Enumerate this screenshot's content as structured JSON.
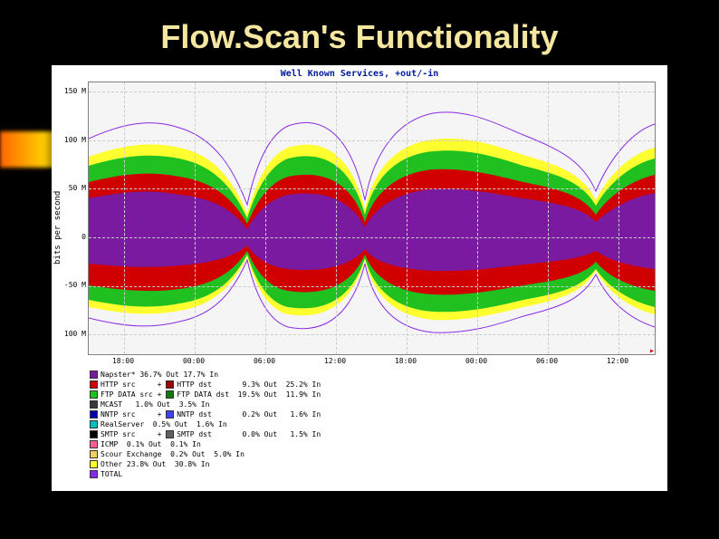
{
  "slide": {
    "title": "Flow.Scan's Functionality"
  },
  "chart_data": {
    "type": "area",
    "title": "Well Known Services, +out/-in",
    "ylabel": "bits per second",
    "xlabel": "",
    "ylim": [
      -120,
      160
    ],
    "y_unit": "M",
    "y_ticks": [
      "150 M",
      "100 M",
      "50 M",
      "0",
      "-50 M",
      "100 M"
    ],
    "x_ticks": [
      "18:00",
      "00:00",
      "06:00",
      "12:00",
      "18:00",
      "00:00",
      "06:00",
      "12:00"
    ],
    "series": [
      {
        "name": "Napster*",
        "color": "#7a1aa0",
        "out_pct": 36.7,
        "in_pct": 17.7
      },
      {
        "name": "HTTP src",
        "color": "#d00000",
        "pair": "HTTP dst",
        "pair_color": "#a00000",
        "out_pct": 9.3,
        "in_pct": 25.2
      },
      {
        "name": "FTP DATA src",
        "color": "#20c020",
        "pair": "FTP DATA dst",
        "pair_color": "#0e7a0e",
        "out_pct": 19.5,
        "in_pct": 11.9
      },
      {
        "name": "MCAST",
        "color": "#3a3a3a",
        "out_pct": 1.0,
        "in_pct": 3.5
      },
      {
        "name": "NNTP src",
        "color": "#0000b0",
        "pair": "NNTP dst",
        "pair_color": "#4040ff",
        "out_pct": 0.2,
        "in_pct": 1.6
      },
      {
        "name": "RealServer",
        "color": "#00c0c0",
        "out_pct": 0.5,
        "in_pct": 1.6
      },
      {
        "name": "SMTP src",
        "color": "#000000",
        "pair": "SMTP dst",
        "pair_color": "#606060",
        "out_pct": 0.0,
        "in_pct": 1.5
      },
      {
        "name": "ICMP",
        "color": "#ff6090",
        "out_pct": 0.1,
        "in_pct": 0.1
      },
      {
        "name": "Scour Exchange",
        "color": "#f0d060",
        "out_pct": 0.2,
        "in_pct": 5.0
      },
      {
        "name": "Other",
        "color": "#ffff30",
        "out_pct": 23.8,
        "in_pct": 30.8
      },
      {
        "name": "TOTAL",
        "color": "#8a2be2",
        "line_only": true
      }
    ],
    "approx_stacked_out_peak_M": 115,
    "approx_stacked_in_peak_M": 100,
    "approx_total_out_peak_M": 150,
    "approx_total_in_peak_M": 105
  },
  "legend_rows": [
    {
      "swatches": [
        {
          "c": "#7a1aa0"
        }
      ],
      "text": "Napster* 36.7% Out 17.7% In"
    },
    {
      "swatches": [
        {
          "c": "#d00000"
        }
      ],
      "mid": "HTTP src     + ",
      "swatches2": [
        {
          "c": "#a00000"
        }
      ],
      "text2": "HTTP dst       9.3% Out  25.2% In"
    },
    {
      "swatches": [
        {
          "c": "#20c020"
        }
      ],
      "mid": "FTP DATA src + ",
      "swatches2": [
        {
          "c": "#0e7a0e"
        }
      ],
      "text2": "FTP DATA dst  19.5% Out  11.9% In"
    },
    {
      "swatches": [
        {
          "c": "#3a3a3a"
        }
      ],
      "text": "MCAST   1.0% Out  3.5% In"
    },
    {
      "swatches": [
        {
          "c": "#0000b0"
        }
      ],
      "mid": "NNTP src     + ",
      "swatches2": [
        {
          "c": "#4040ff"
        }
      ],
      "text2": "NNTP dst       0.2% Out   1.6% In"
    },
    {
      "swatches": [
        {
          "c": "#00c0c0"
        }
      ],
      "text": "RealServer  0.5% Out  1.6% In"
    },
    {
      "swatches": [
        {
          "c": "#000000"
        }
      ],
      "mid": "SMTP src     + ",
      "swatches2": [
        {
          "c": "#606060"
        }
      ],
      "text2": "SMTP dst       0.0% Out   1.5% In"
    },
    {
      "swatches": [
        {
          "c": "#ff6090"
        }
      ],
      "text": "ICMP  0.1% Out  0.1% In"
    },
    {
      "swatches": [
        {
          "c": "#f0d060"
        }
      ],
      "text": "Scour Exchange  0.2% Out  5.0% In"
    },
    {
      "swatches": [
        {
          "c": "#ffff30"
        }
      ],
      "text": "Other 23.8% Out  30.8% In"
    },
    {
      "swatches": [
        {
          "c": "#8a2be2"
        }
      ],
      "text": "TOTAL"
    }
  ]
}
